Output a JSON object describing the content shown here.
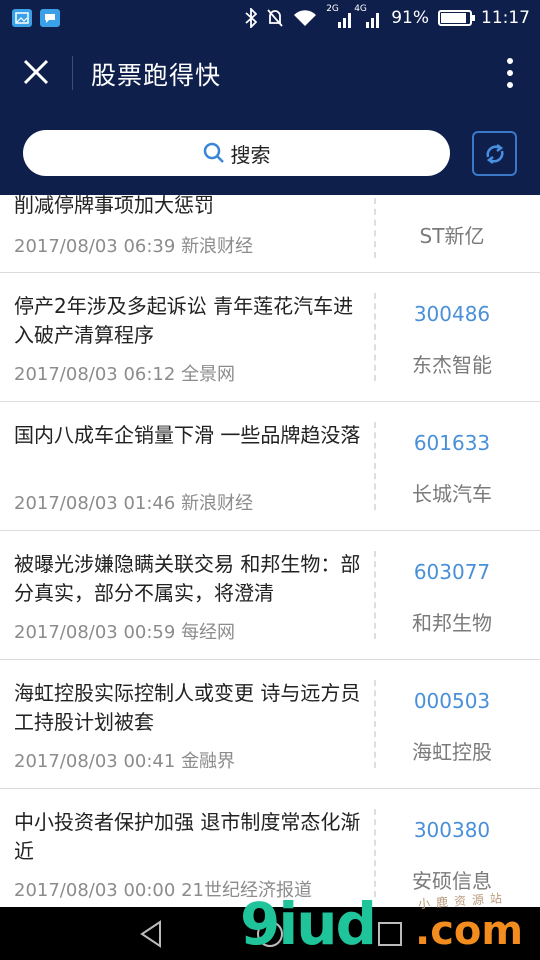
{
  "status_bar": {
    "signal_2g": "2G",
    "signal_4g": "4G",
    "battery_percent": "91%",
    "battery_level": 0.91,
    "time": "11:17"
  },
  "header": {
    "title": "股票跑得快",
    "search_label": "搜索"
  },
  "news": [
    {
      "headline": "削减停牌事项加大惩罚",
      "meta": "2017/08/03 06:39 新浪财经",
      "code": "",
      "name": "ST新亿"
    },
    {
      "headline": "停产2年涉及多起诉讼 青年莲花汽车进入破产清算程序",
      "meta": "2017/08/03 06:12 全景网",
      "code": "300486",
      "name": "东杰智能"
    },
    {
      "headline": "国内八成车企销量下滑 一些品牌趋没落",
      "meta": "2017/08/03 01:46 新浪财经",
      "code": "601633",
      "name": "长城汽车"
    },
    {
      "headline": "被曝光涉嫌隐瞒关联交易 和邦生物：部分真实，部分不属实，将澄清",
      "meta": "2017/08/03 00:59 每经网",
      "code": "603077",
      "name": "和邦生物"
    },
    {
      "headline": "海虹控股实际控制人或变更 诗与远方员工持股计划被套",
      "meta": "2017/08/03 00:41 金融界",
      "code": "000503",
      "name": "海虹控股"
    },
    {
      "headline": "中小投资者保护加强 退市制度常态化渐近",
      "meta": "2017/08/03 00:00 21世纪经济报道",
      "code": "300380",
      "name": "安硕信息"
    }
  ],
  "watermark": {
    "main": "9iud",
    "suffix": ".com",
    "small": "小鹿资源站"
  },
  "colors": {
    "header_bg": "#0f1f4c",
    "stock_code": "#4a90d9",
    "refresh_border": "#3a78c8"
  },
  "icons": [
    "image-notification-icon",
    "chat-notification-icon",
    "bluetooth-icon",
    "mute-icon",
    "wifi-icon",
    "signal-icon",
    "battery-icon",
    "close-icon",
    "more-vertical-icon",
    "search-icon",
    "refresh-icon",
    "back-nav-icon",
    "home-nav-icon",
    "recents-nav-icon"
  ]
}
